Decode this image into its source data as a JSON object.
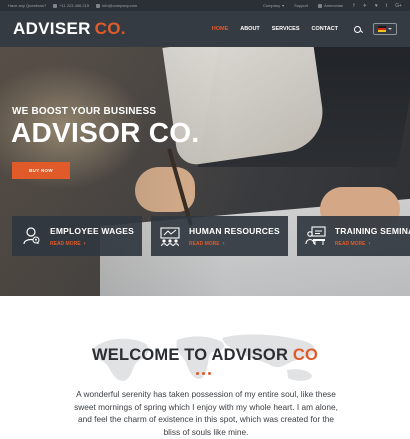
{
  "topbar": {
    "question": "Have any Questions?",
    "phone": "+11 223 456 215",
    "email": "info@company.com",
    "company": "Company",
    "support": "Support",
    "account": "Ammonian",
    "social": [
      "f",
      "✈",
      "♥",
      "t",
      "G+"
    ]
  },
  "header": {
    "logo_main": "ADVISER",
    "logo_accent": "CO.",
    "nav": [
      "HOME",
      "ABOUT",
      "SERVICES",
      "CONTACT"
    ],
    "active_nav": "HOME"
  },
  "hero": {
    "subtitle": "WE BOOST YOUR BUSINESS",
    "title": "ADVISOR CO.",
    "button": "BUY NOW",
    "cards": [
      {
        "title": "EMPLOYEE WAGES",
        "more": "READ MORE",
        "icon": "employee-icon"
      },
      {
        "title": "HUMAN RESOURCES",
        "more": "READ MORE",
        "icon": "team-icon"
      },
      {
        "title": "TRAINING SEMINAR",
        "more": "READ MORE",
        "icon": "seminar-icon"
      }
    ]
  },
  "welcome": {
    "title_main": "WELCOME TO ADVISOR",
    "title_accent": "CO",
    "body": "A wonderful serenity has taken possession of my entire soul, like these sweet mornings of spring which I enjoy with my whole heart. I am alone, and feel the charm of existence in this spot, which was created for the bliss of souls like mine."
  },
  "colors": {
    "accent": "#e05a2a",
    "header_bg": "#353b42",
    "topbar_bg": "#2b3036",
    "card_bg": "#30373f"
  }
}
